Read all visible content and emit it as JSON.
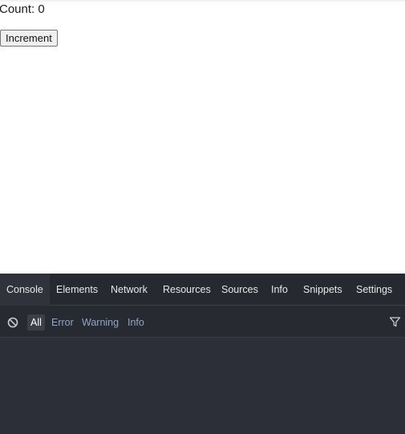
{
  "app": {
    "count_text": "Count: 0",
    "increment_label": "Increment"
  },
  "devtools": {
    "tabs": [
      {
        "label": "Console",
        "active": true
      },
      {
        "label": "Elements",
        "active": false
      },
      {
        "label": "Network",
        "active": false
      },
      {
        "label": "Resources",
        "active": false
      },
      {
        "label": "Sources",
        "active": false
      },
      {
        "label": "Info",
        "active": false
      },
      {
        "label": "Snippets",
        "active": false
      },
      {
        "label": "Settings",
        "active": false
      }
    ],
    "filters": [
      {
        "label": "All",
        "active": true
      },
      {
        "label": "Error",
        "active": false
      },
      {
        "label": "Warning",
        "active": false
      },
      {
        "label": "Info",
        "active": false
      }
    ],
    "icons": {
      "clear": "clear-console-icon",
      "filter": "funnel-icon"
    },
    "colors": {
      "panel_bg": "#2c2f37",
      "tab_bar_bg": "#262930",
      "filter_text": "#8ea6c8"
    }
  }
}
